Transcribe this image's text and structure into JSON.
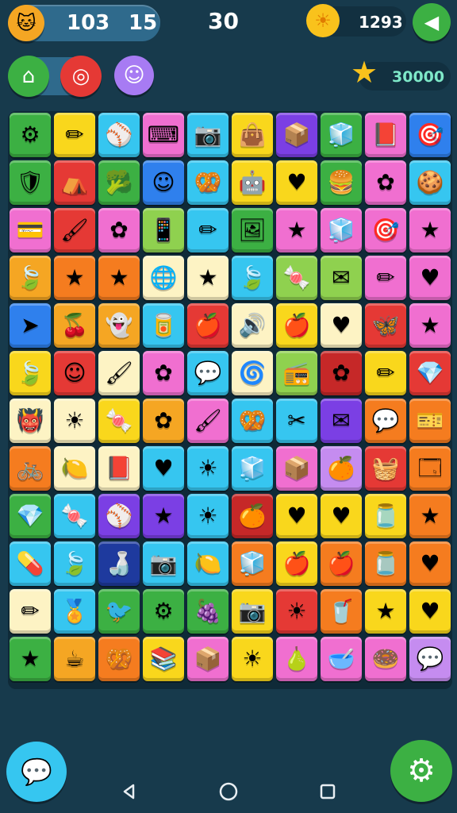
{
  "hud": {
    "moves": "103",
    "level": "15",
    "timer": "30",
    "coins": "1293",
    "score": "30000"
  },
  "colors": {
    "background": "#173a4c",
    "board": "#0f2a38",
    "accent_orange": "#f5a623",
    "accent_green": "#3cb043",
    "accent_red": "#e53935",
    "accent_purple": "#a77bf3",
    "accent_cyan": "#36c6f0"
  },
  "board": {
    "rows": 12,
    "cols": 10,
    "tiles": [
      [
        {
          "c": "#3cb043",
          "i": "gear-icon"
        },
        {
          "c": "#f9d71c",
          "i": "pencil-icon"
        },
        {
          "c": "#36c6f0",
          "i": "ball-icon"
        },
        {
          "c": "#f06fd0",
          "i": "keyboard-icon"
        },
        {
          "c": "#36c6f0",
          "i": "camera-icon"
        },
        {
          "c": "#f9d71c",
          "i": "bag-icon"
        },
        {
          "c": "#7b3fe4",
          "i": "box-icon"
        },
        {
          "c": "#3cb043",
          "i": "cube-icon"
        },
        {
          "c": "#f06fd0",
          "i": "book-icon"
        },
        {
          "c": "#2f80ed",
          "i": "target-icon"
        }
      ],
      [
        {
          "c": "#3cb043",
          "i": "shield-icon"
        },
        {
          "c": "#e53935",
          "i": "tent-icon"
        },
        {
          "c": "#3cb043",
          "i": "broccoli-icon"
        },
        {
          "c": "#2f80ed",
          "i": "smiley-icon"
        },
        {
          "c": "#36c6f0",
          "i": "knot-icon"
        },
        {
          "c": "#f9d71c",
          "i": "robot-icon"
        },
        {
          "c": "#f9d71c",
          "i": "heart-icon"
        },
        {
          "c": "#3cb043",
          "i": "cake-icon"
        },
        {
          "c": "#f06fd0",
          "i": "flower-icon"
        },
        {
          "c": "#36c6f0",
          "i": "cookie-icon"
        }
      ],
      [
        {
          "c": "#f06fd0",
          "i": "card-icon"
        },
        {
          "c": "#e53935",
          "i": "brush-icon"
        },
        {
          "c": "#f06fd0",
          "i": "flower-icon"
        },
        {
          "c": "#8fd14f",
          "i": "phone-icon"
        },
        {
          "c": "#36c6f0",
          "i": "pencil-icon"
        },
        {
          "c": "#3cb043",
          "i": "frame-icon"
        },
        {
          "c": "#f06fd0",
          "i": "star-icon"
        },
        {
          "c": "#f06fd0",
          "i": "cube-icon"
        },
        {
          "c": "#f06fd0",
          "i": "target-icon"
        },
        {
          "c": "#f06fd0",
          "i": "star-icon"
        }
      ],
      [
        {
          "c": "#f5a623",
          "i": "leaf-icon"
        },
        {
          "c": "#f57c1f",
          "i": "star-icon"
        },
        {
          "c": "#f57c1f",
          "i": "star-icon"
        },
        {
          "c": "#fdf3c4",
          "i": "globe-icon"
        },
        {
          "c": "#fdf3c4",
          "i": "star-icon"
        },
        {
          "c": "#36c6f0",
          "i": "leaf-icon"
        },
        {
          "c": "#8fd14f",
          "i": "candy-icon"
        },
        {
          "c": "#8fd14f",
          "i": "envelope-icon"
        },
        {
          "c": "#f06fd0",
          "i": "pencil-icon"
        },
        {
          "c": "#f06fd0",
          "i": "heart-icon"
        }
      ],
      [
        {
          "c": "#2f80ed",
          "i": "arrow-icon"
        },
        {
          "c": "#f5a623",
          "i": "cherry-icon"
        },
        {
          "c": "#f5a623",
          "i": "ghost-icon"
        },
        {
          "c": "#36c6f0",
          "i": "can-icon"
        },
        {
          "c": "#e53935",
          "i": "apple-icon"
        },
        {
          "c": "#fdf3c4",
          "i": "speaker-icon"
        },
        {
          "c": "#f9d71c",
          "i": "apple-icon"
        },
        {
          "c": "#fdf3c4",
          "i": "heart-icon"
        },
        {
          "c": "#e53935",
          "i": "butterfly-icon"
        },
        {
          "c": "#f06fd0",
          "i": "star-icon"
        }
      ],
      [
        {
          "c": "#f9d71c",
          "i": "leaf-icon"
        },
        {
          "c": "#e53935",
          "i": "smiley-icon"
        },
        {
          "c": "#fdf3c4",
          "i": "brush-icon"
        },
        {
          "c": "#f06fd0",
          "i": "flower-icon"
        },
        {
          "c": "#36c6f0",
          "i": "bubble-icon"
        },
        {
          "c": "#fdf3c4",
          "i": "swirl-icon"
        },
        {
          "c": "#8fd14f",
          "i": "radio-icon"
        },
        {
          "c": "#c62828",
          "i": "flower-icon"
        },
        {
          "c": "#f9d71c",
          "i": "pencil-icon"
        },
        {
          "c": "#e53935",
          "i": "gem-icon"
        }
      ],
      [
        {
          "c": "#fdf3c4",
          "i": "monster-icon"
        },
        {
          "c": "#fdf3c4",
          "i": "sun-icon"
        },
        {
          "c": "#f9d71c",
          "i": "candy-icon"
        },
        {
          "c": "#f5a623",
          "i": "flower-icon"
        },
        {
          "c": "#f06fd0",
          "i": "brush-icon"
        },
        {
          "c": "#36c6f0",
          "i": "knot-icon"
        },
        {
          "c": "#36c6f0",
          "i": "scissors-icon"
        },
        {
          "c": "#7b3fe4",
          "i": "envelope-icon"
        },
        {
          "c": "#f57c1f",
          "i": "bubble-icon"
        },
        {
          "c": "#f57c1f",
          "i": "ticket-icon"
        }
      ],
      [
        {
          "c": "#f57c1f",
          "i": "bike-icon"
        },
        {
          "c": "#fdf3c4",
          "i": "lemon-icon"
        },
        {
          "c": "#fdf3c4",
          "i": "book-icon"
        },
        {
          "c": "#36c6f0",
          "i": "heart-icon"
        },
        {
          "c": "#36c6f0",
          "i": "sun-icon"
        },
        {
          "c": "#36c6f0",
          "i": "cube-icon"
        },
        {
          "c": "#f06fd0",
          "i": "box-icon"
        },
        {
          "c": "#c58cf0",
          "i": "orange-icon"
        },
        {
          "c": "#e53935",
          "i": "washer-icon"
        },
        {
          "c": "#f57c1f",
          "i": "window-icon"
        }
      ],
      [
        {
          "c": "#3cb043",
          "i": "gem-icon"
        },
        {
          "c": "#36c6f0",
          "i": "candy-icon"
        },
        {
          "c": "#7b3fe4",
          "i": "ball-icon"
        },
        {
          "c": "#7b3fe4",
          "i": "star-icon"
        },
        {
          "c": "#36c6f0",
          "i": "sun-icon"
        },
        {
          "c": "#c62828",
          "i": "orange-icon"
        },
        {
          "c": "#f9d71c",
          "i": "heart-icon"
        },
        {
          "c": "#f9d71c",
          "i": "heart-icon"
        },
        {
          "c": "#f9d71c",
          "i": "jar-icon"
        },
        {
          "c": "#f57c1f",
          "i": "star-icon"
        }
      ],
      [
        {
          "c": "#36c6f0",
          "i": "pill-icon"
        },
        {
          "c": "#36c6f0",
          "i": "leaf-icon"
        },
        {
          "c": "#1e3a9e",
          "i": "bottle-icon"
        },
        {
          "c": "#36c6f0",
          "i": "camera-icon"
        },
        {
          "c": "#36c6f0",
          "i": "lemon-icon"
        },
        {
          "c": "#f57c1f",
          "i": "cube-icon"
        },
        {
          "c": "#f9d71c",
          "i": "apple-icon"
        },
        {
          "c": "#f57c1f",
          "i": "apple-icon"
        },
        {
          "c": "#f57c1f",
          "i": "jar-icon"
        },
        {
          "c": "#f57c1f",
          "i": "heart-icon"
        }
      ],
      [
        {
          "c": "#fdf3c4",
          "i": "pencil-icon"
        },
        {
          "c": "#36c6f0",
          "i": "badge-icon"
        },
        {
          "c": "#3cb043",
          "i": "bird-icon"
        },
        {
          "c": "#3cb043",
          "i": "gear-icon"
        },
        {
          "c": "#3cb043",
          "i": "grapes-icon"
        },
        {
          "c": "#f9d71c",
          "i": "camera-icon"
        },
        {
          "c": "#e53935",
          "i": "sun-icon"
        },
        {
          "c": "#f57c1f",
          "i": "glass-icon"
        },
        {
          "c": "#f9d71c",
          "i": "star-icon"
        },
        {
          "c": "#f9d71c",
          "i": "heart-icon"
        }
      ],
      [
        {
          "c": "#3cb043",
          "i": "star-icon"
        },
        {
          "c": "#f5a623",
          "i": "cup-icon"
        },
        {
          "c": "#f57c1f",
          "i": "knot-icon"
        },
        {
          "c": "#f9d71c",
          "i": "books-icon"
        },
        {
          "c": "#f06fd0",
          "i": "box-icon"
        },
        {
          "c": "#f9d71c",
          "i": "sun-icon"
        },
        {
          "c": "#f06fd0",
          "i": "pear-icon"
        },
        {
          "c": "#f06fd0",
          "i": "bowl-icon"
        },
        {
          "c": "#f06fd0",
          "i": "donut-icon"
        },
        {
          "c": "#c58cf0",
          "i": "bubble-icon"
        }
      ]
    ]
  },
  "glyphs": {
    "gear-icon": "⚙",
    "pencil-icon": "✏",
    "ball-icon": "⚾",
    "keyboard-icon": "⌨",
    "camera-icon": "📷",
    "bag-icon": "👜",
    "box-icon": "📦",
    "cube-icon": "🧊",
    "book-icon": "📕",
    "target-icon": "🎯",
    "shield-icon": "🛡",
    "tent-icon": "⛺",
    "broccoli-icon": "🥦",
    "smiley-icon": "☺",
    "knot-icon": "🥨",
    "robot-icon": "🤖",
    "heart-icon": "♥",
    "cake-icon": "🍔",
    "flower-icon": "✿",
    "cookie-icon": "🍪",
    "card-icon": "💳",
    "brush-icon": "🖌",
    "phone-icon": "📱",
    "frame-icon": "🖼",
    "star-icon": "★",
    "leaf-icon": "🍃",
    "globe-icon": "🌐",
    "candy-icon": "🍬",
    "envelope-icon": "✉",
    "arrow-icon": "➤",
    "cherry-icon": "🍒",
    "ghost-icon": "👻",
    "can-icon": "🥫",
    "apple-icon": "🍎",
    "speaker-icon": "🔊",
    "butterfly-icon": "🦋",
    "bubble-icon": "💬",
    "swirl-icon": "🌀",
    "radio-icon": "📻",
    "gem-icon": "💎",
    "monster-icon": "👹",
    "sun-icon": "☀",
    "ticket-icon": "🎫",
    "bike-icon": "🚲",
    "lemon-icon": "🍋",
    "orange-icon": "🍊",
    "washer-icon": "🧺",
    "window-icon": "🗔",
    "jar-icon": "🫙",
    "pill-icon": "💊",
    "bottle-icon": "🍶",
    "badge-icon": "🏅",
    "bird-icon": "🐦",
    "grapes-icon": "🍇",
    "glass-icon": "🥤",
    "cup-icon": "☕",
    "books-icon": "📚",
    "pear-icon": "🍐",
    "bowl-icon": "🥣",
    "donut-icon": "🍩",
    "scissors-icon": "✂"
  }
}
